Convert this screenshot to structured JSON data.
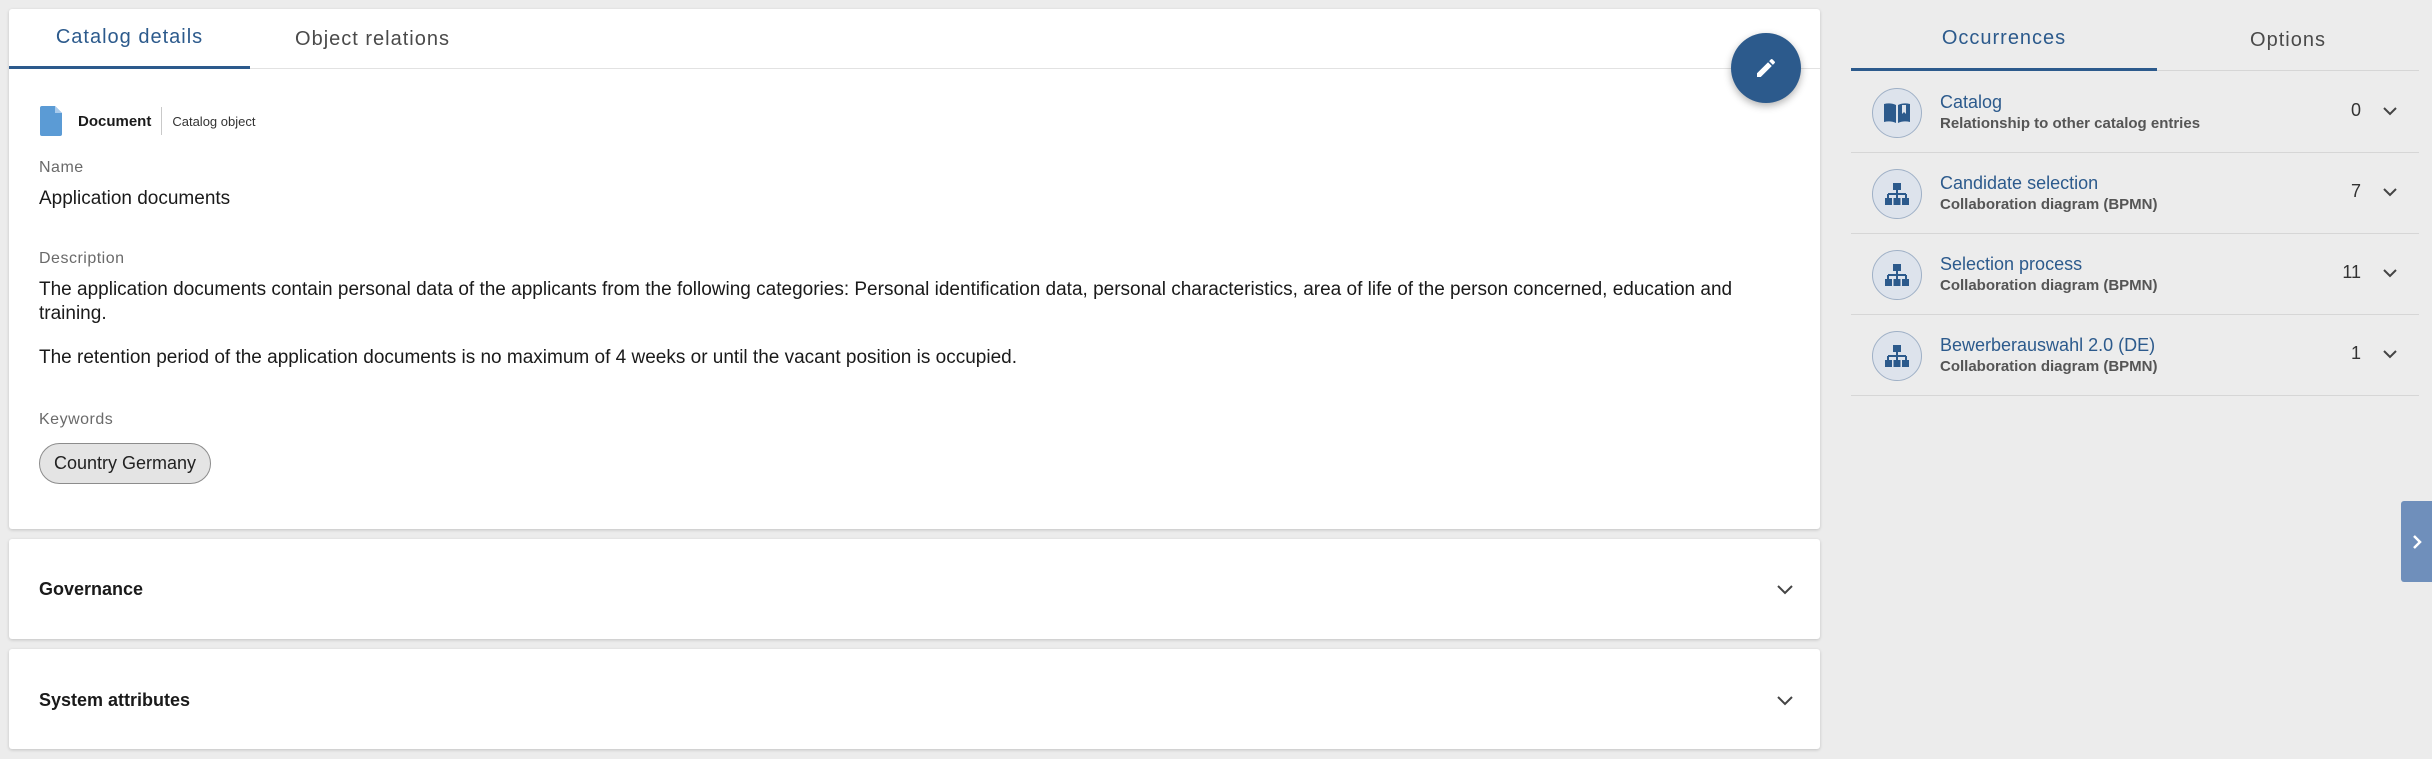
{
  "main": {
    "tabs": [
      {
        "label": "Catalog details"
      },
      {
        "label": "Object relations"
      }
    ],
    "edit_icon": "pencil-icon",
    "object_type": "Document",
    "object_kind": "Catalog object",
    "name_label": "Name",
    "name_value": "Application documents",
    "description_label": "Description",
    "description_p1": "The application documents contain personal data of the applicants from the following categories: Personal identification data, personal characteristics, area of life of the person concerned, education and training.",
    "description_p2": "The retention period of the application documents is no maximum of 4 weeks or until the vacant position is occupied.",
    "keywords_label": "Keywords",
    "keywords": [
      "Country Germany"
    ]
  },
  "panels": [
    {
      "title": "Governance"
    },
    {
      "title": "System attributes"
    }
  ],
  "side": {
    "tabs": [
      {
        "label": "Occurrences"
      },
      {
        "label": "Options"
      }
    ],
    "occurrences": [
      {
        "name": "Catalog",
        "sub": "Relationship to other catalog entries",
        "count": "0",
        "icon": "book-icon"
      },
      {
        "name": "Candidate selection",
        "sub": "Collaboration diagram (BPMN)",
        "count": "7",
        "icon": "hierarchy-icon"
      },
      {
        "name": "Selection process",
        "sub": "Collaboration diagram (BPMN)",
        "count": "11",
        "icon": "hierarchy-icon"
      },
      {
        "name": "Bewerberauswahl 2.0 (DE)",
        "sub": "Collaboration diagram (BPMN)",
        "count": "1",
        "icon": "hierarchy-icon"
      }
    ]
  },
  "colors": {
    "accent": "#2c5a8c",
    "doc_icon": "#5b9bd5",
    "side_toggle": "#6f8fbb",
    "background": "#ececec"
  }
}
